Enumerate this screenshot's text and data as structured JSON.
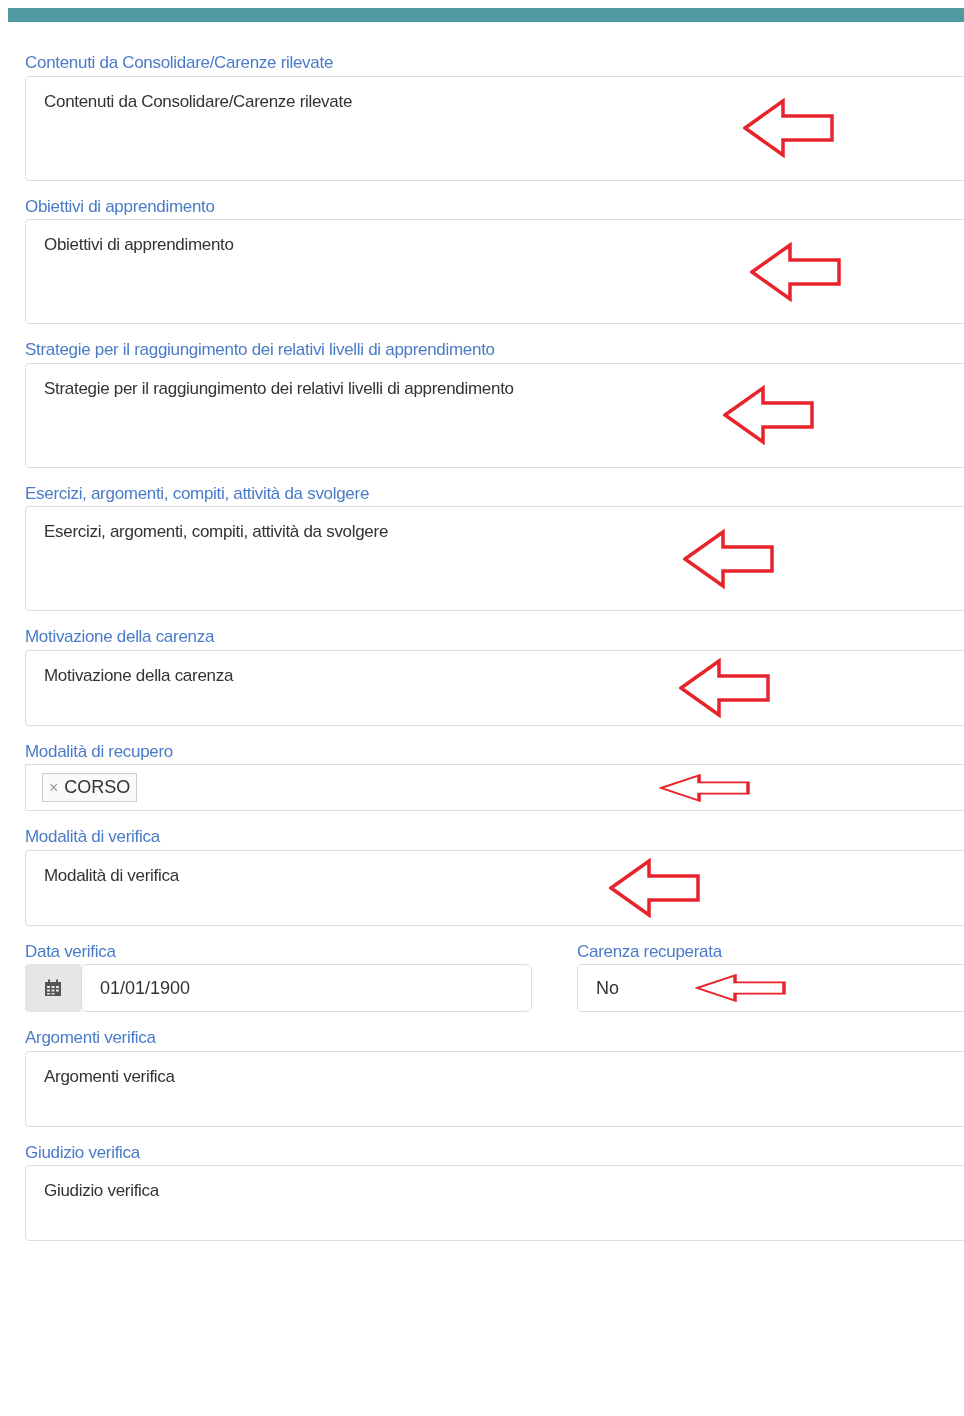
{
  "fields": [
    {
      "kind": "textarea",
      "label": "Contenuti da Consolidare/Carenze rilevate",
      "value": "Contenuti da Consolidare/Carenze rilevate",
      "arrow": true
    },
    {
      "kind": "textarea",
      "label": "Obiettivi di apprendimento",
      "value": "Obiettivi di apprendimento",
      "arrow": true
    },
    {
      "kind": "textarea",
      "label": "Strategie per il raggiungimento dei relativi livelli di apprendimento",
      "value": "Strategie per il raggiungimento dei relativi livelli di apprendimento",
      "arrow": true
    },
    {
      "kind": "textarea",
      "label": "Esercizi, argomenti, compiti, attività da svolgere",
      "value": "Esercizi, argomenti, compiti, attività da svolgere",
      "arrow": true
    },
    {
      "kind": "short",
      "label": "Motivazione della carenza",
      "value": "Motivazione della carenza",
      "arrow": true
    },
    {
      "kind": "tags",
      "label": "Modalità di recupero",
      "tags": [
        {
          "remove_symbol": "×",
          "text": "CORSO"
        }
      ],
      "arrow": true
    },
    {
      "kind": "short",
      "label": "Modalità di verifica",
      "value": "Modalità di verifica",
      "arrow": true
    },
    {
      "kind": "pair",
      "items": [
        {
          "kind": "date",
          "label": "Data verifica",
          "value": "01/01/1900",
          "arrow": false
        },
        {
          "kind": "select",
          "label": "Carenza recuperata",
          "value": "No",
          "arrow": true
        }
      ]
    },
    {
      "kind": "short",
      "label": "Argomenti verifica",
      "value": "Argomenti verifica",
      "arrow": false
    },
    {
      "kind": "short",
      "label": "Giudizio verifica",
      "value": "Giudizio verifica",
      "arrow": false
    }
  ]
}
